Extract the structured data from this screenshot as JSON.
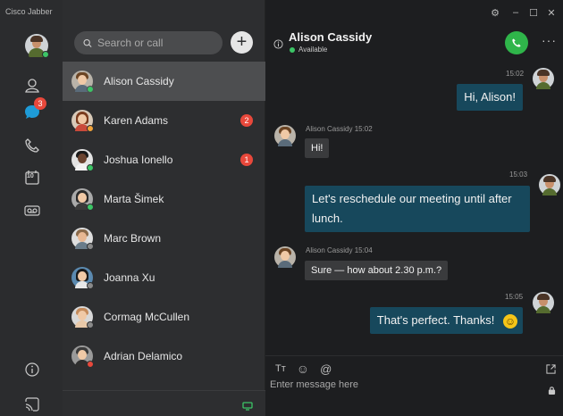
{
  "app": {
    "title": "Cisco Jabber"
  },
  "rail": {
    "chats_badge": "3",
    "calendar_day": "10"
  },
  "search": {
    "placeholder": "Search or call",
    "add_label": "+"
  },
  "contacts": [
    {
      "name": "Alison Cassidy",
      "badge": "",
      "status": "available",
      "active": true
    },
    {
      "name": "Karen Adams",
      "badge": "2",
      "status": "away",
      "active": false
    },
    {
      "name": "Joshua Ionello",
      "badge": "1",
      "status": "available",
      "active": false
    },
    {
      "name": "Marta Šimek",
      "badge": "",
      "status": "available",
      "active": false
    },
    {
      "name": "Marc Brown",
      "badge": "",
      "status": "offline",
      "active": false
    },
    {
      "name": "Joanna Xu",
      "badge": "",
      "status": "offline",
      "active": false
    },
    {
      "name": "Cormag McCullen",
      "badge": "",
      "status": "offline",
      "active": false
    },
    {
      "name": "Adrian Delamico",
      "badge": "",
      "status": "busy",
      "active": false
    }
  ],
  "chat": {
    "peer_name": "Alison Cassidy",
    "peer_status": "Available",
    "more_label": "···",
    "messages": [
      {
        "dir": "out",
        "time": "15:02",
        "text": "Hi, Alison!"
      },
      {
        "dir": "in",
        "sender_time": "Alison Cassidy 15:02",
        "text": "Hi!"
      },
      {
        "dir": "out",
        "time": "15:03",
        "text": "Let's reschedule our meeting until after lunch."
      },
      {
        "dir": "in",
        "sender_time": "Alison Cassidy 15:04",
        "text": "Sure — how about 2.30 p.m.?"
      },
      {
        "dir": "out",
        "time": "15:05",
        "text": "That's perfect. Thanks!",
        "emoji": "☺"
      }
    ],
    "composer": {
      "placeholder": "Enter message here",
      "format_label": "Tт",
      "emoji_label": "☺",
      "mention_label": "@"
    }
  },
  "window": {
    "min": "–",
    "max": "☐",
    "close": "✕"
  },
  "colors": {
    "accent_blue": "#17485c",
    "available": "#3cc566",
    "badge_red": "#e8483b",
    "call_green": "#2fb54a"
  }
}
